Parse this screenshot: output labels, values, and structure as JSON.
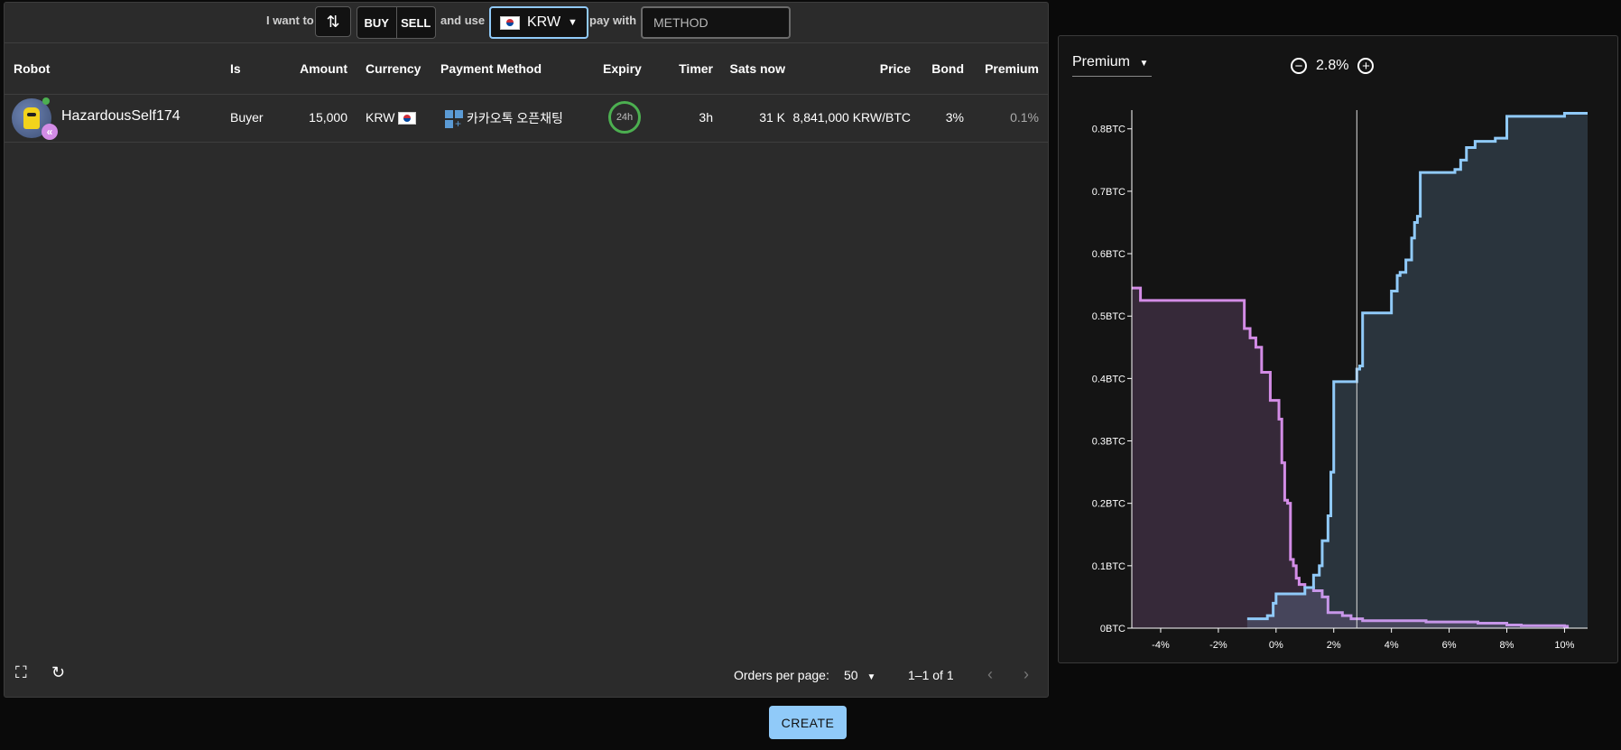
{
  "filters": {
    "i_want_to": "I want to",
    "buy": "BUY",
    "sell": "SELL",
    "and_use": "and use",
    "currency": "KRW",
    "pay_with": "pay with",
    "method_placeholder": "METHOD"
  },
  "table": {
    "headers": [
      "Robot",
      "Is",
      "Amount",
      "Currency",
      "Payment Method",
      "Expiry",
      "Timer",
      "Sats now",
      "Price",
      "Bond",
      "Premium"
    ],
    "rows": [
      {
        "robot": "HazardousSelf174",
        "is": "Buyer",
        "amount": "15,000",
        "currency": "KRW",
        "payment_method": "카카오톡 오픈채팅",
        "expiry": "24h",
        "timer": "3h",
        "sats_now": "31 K",
        "price": "8,841,000 KRW/BTC",
        "bond": "3%",
        "premium": "0.1%"
      }
    ]
  },
  "footer": {
    "orders_per_page_label": "Orders per page:",
    "orders_per_page_value": "50",
    "range": "1–1 of 1"
  },
  "create_button": "CREATE",
  "depth_chart": {
    "selector": "Premium",
    "zoom_value": "2.8%"
  },
  "chart_data": {
    "type": "area",
    "x_unit": "premium %",
    "xlim": [
      -5,
      10.8
    ],
    "ylim": [
      0,
      0.83
    ],
    "x_ticks": [
      "-4%",
      "-2%",
      "0%",
      "2%",
      "4%",
      "6%",
      "8%",
      "10%"
    ],
    "y_ticks": [
      "0BTC",
      "0.1BTC",
      "0.2BTC",
      "0.3BTC",
      "0.4BTC",
      "0.5BTC",
      "0.6BTC",
      "0.7BTC",
      "0.8BTC"
    ],
    "center_line": 2.8,
    "colors": {
      "buy": "#d38ce6",
      "sell": "#90caf9"
    },
    "series": [
      {
        "x": [
          -5,
          -4.7,
          -1.6,
          -1.1,
          -0.9,
          -0.7,
          -0.5,
          -0.2,
          0.1,
          0.2,
          0.3,
          0.4,
          0.5,
          0.6,
          0.7,
          0.8,
          1.0,
          1.3,
          1.6,
          1.8,
          2.3,
          2.6,
          3.0,
          5.2,
          7.0,
          8.0,
          8.5,
          10.0,
          10.1
        ],
        "y": [
          0.545,
          0.525,
          0.525,
          0.48,
          0.465,
          0.45,
          0.41,
          0.365,
          0.335,
          0.265,
          0.205,
          0.2,
          0.11,
          0.1,
          0.08,
          0.07,
          0.065,
          0.06,
          0.05,
          0.025,
          0.02,
          0.015,
          0.012,
          0.01,
          0.008,
          0.005,
          0.004,
          0.003,
          0.0
        ]
      },
      {
        "x": [
          -1.0,
          -0.3,
          -0.1,
          0.0,
          1.0,
          1.3,
          1.5,
          1.6,
          1.8,
          1.9,
          2.0,
          2.8,
          2.9,
          3.0,
          4.0,
          4.2,
          4.3,
          4.5,
          4.7,
          4.8,
          4.9,
          5.0,
          6.2,
          6.4,
          6.6,
          6.9,
          7.6,
          8.0,
          10.0,
          10.8
        ],
        "y": [
          0.015,
          0.02,
          0.04,
          0.055,
          0.065,
          0.085,
          0.1,
          0.14,
          0.18,
          0.25,
          0.395,
          0.415,
          0.42,
          0.505,
          0.54,
          0.565,
          0.57,
          0.59,
          0.625,
          0.65,
          0.66,
          0.73,
          0.735,
          0.75,
          0.77,
          0.78,
          0.785,
          0.82,
          0.825,
          0.825
        ]
      }
    ]
  }
}
